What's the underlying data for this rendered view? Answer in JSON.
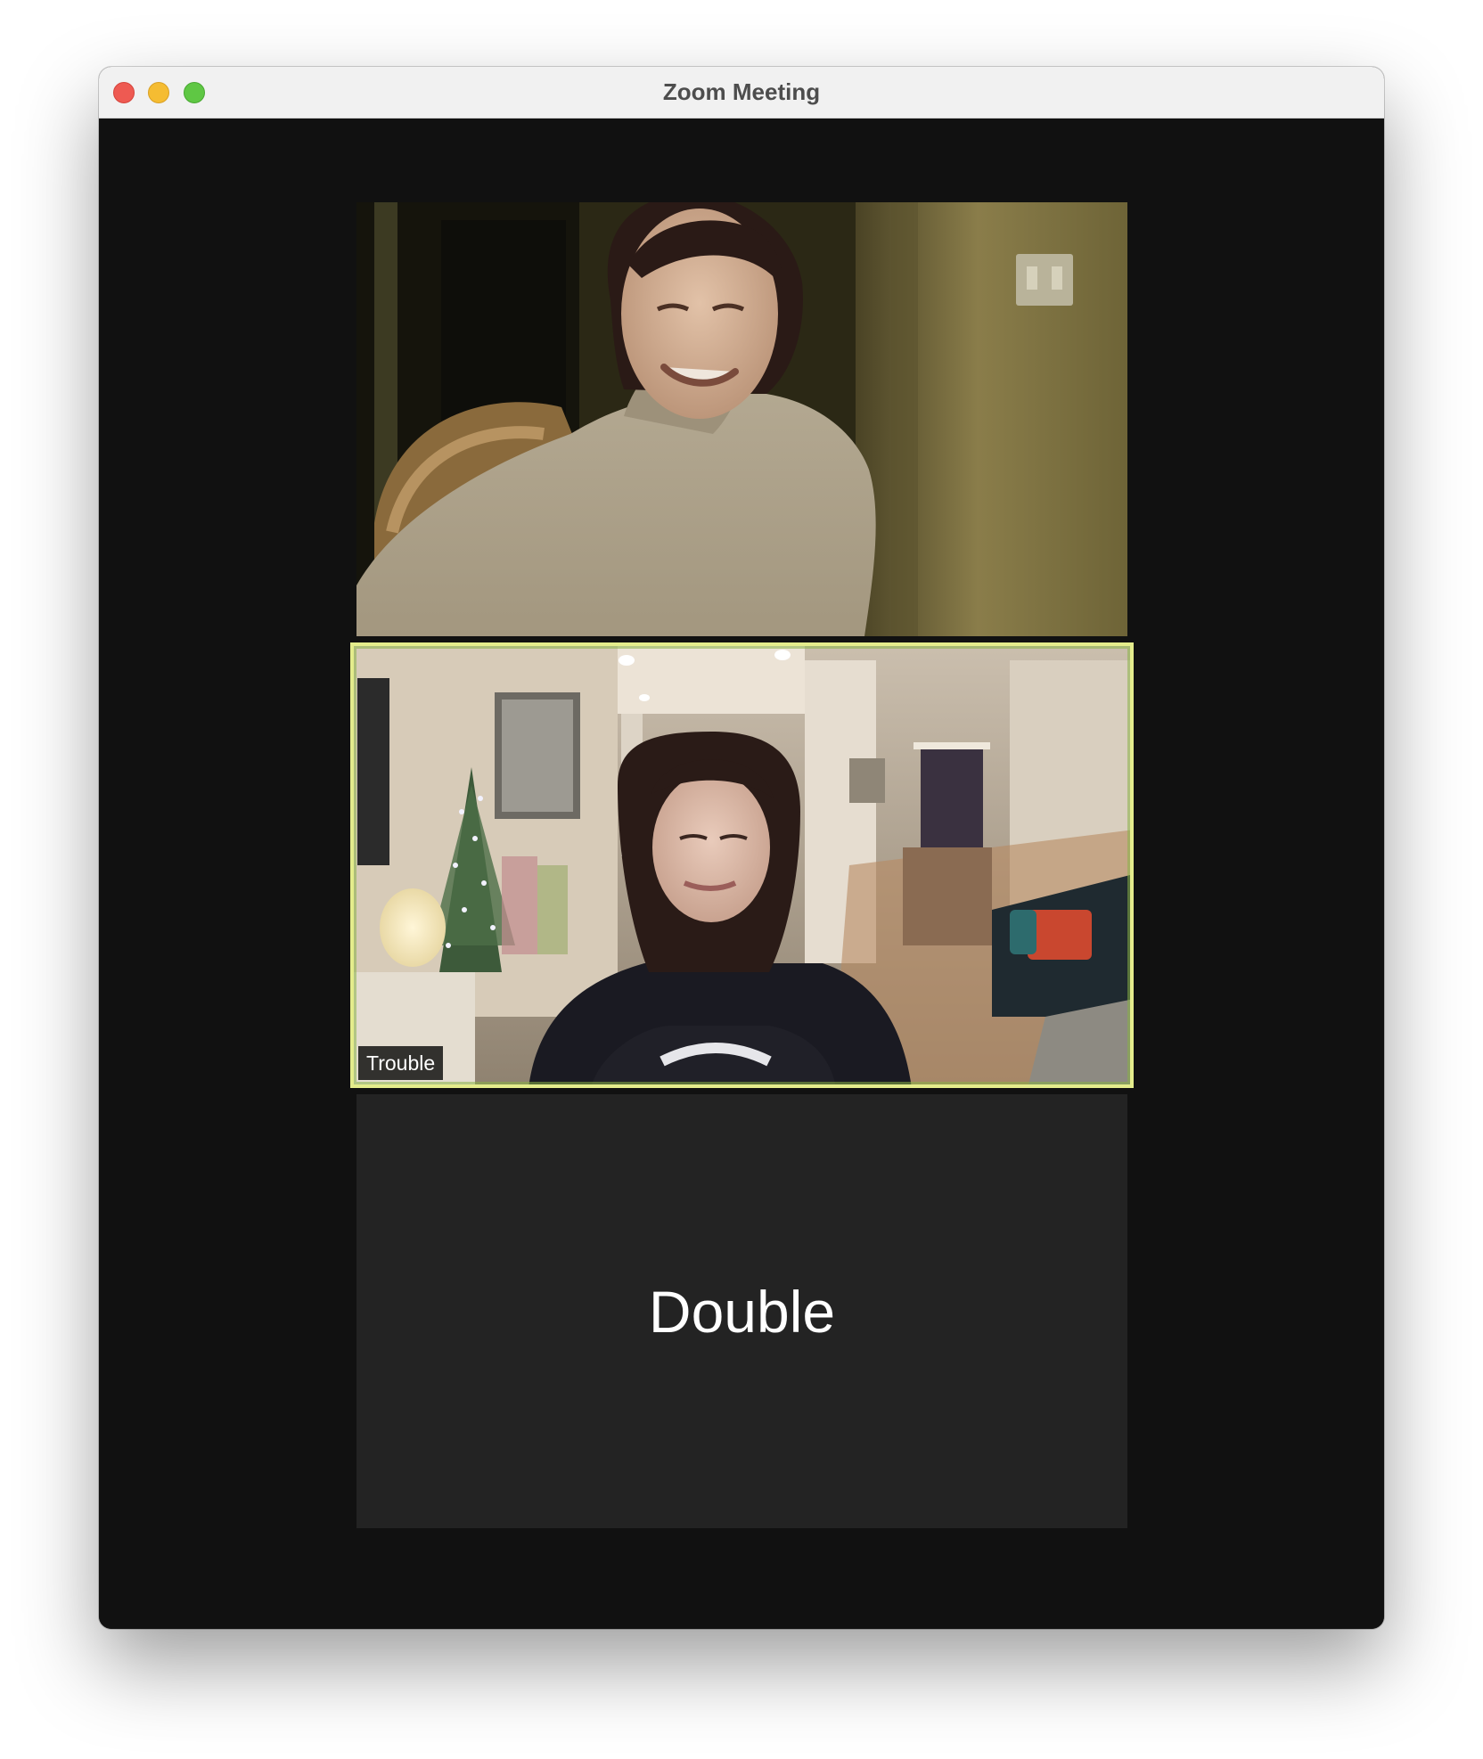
{
  "window": {
    "title": "Zoom Meeting"
  },
  "participants": [
    {
      "name": "",
      "video_on": true,
      "active_speaker": false
    },
    {
      "name": "Trouble",
      "video_on": true,
      "active_speaker": true
    },
    {
      "name": "Double",
      "video_on": false,
      "active_speaker": false
    }
  ],
  "colors": {
    "active_speaker_border": "#e4ec8c",
    "meeting_background": "#111111",
    "camera_off_tile": "#232323"
  }
}
